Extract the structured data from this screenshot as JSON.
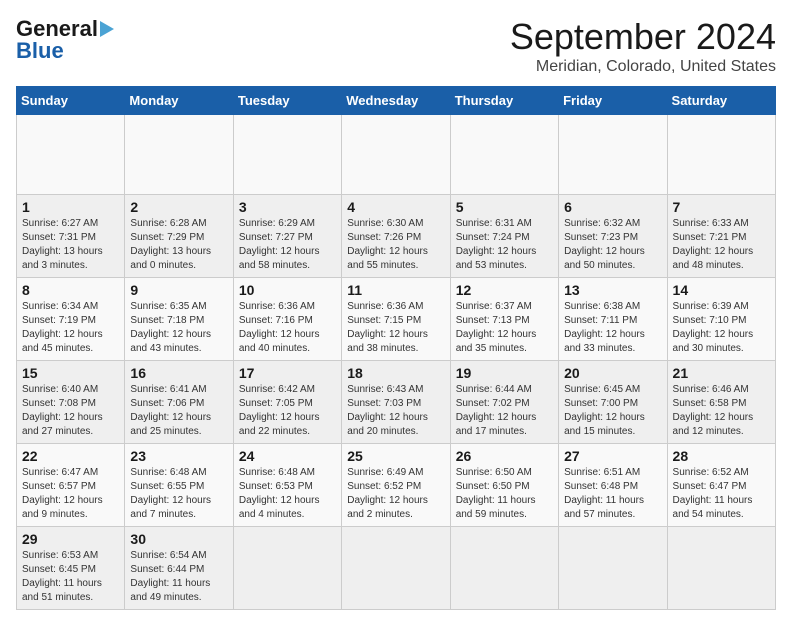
{
  "header": {
    "logo_line1": "General",
    "logo_line2": "Blue",
    "title": "September 2024",
    "subtitle": "Meridian, Colorado, United States"
  },
  "calendar": {
    "days_of_week": [
      "Sunday",
      "Monday",
      "Tuesday",
      "Wednesday",
      "Thursday",
      "Friday",
      "Saturday"
    ],
    "weeks": [
      [
        {
          "day": "",
          "info": ""
        },
        {
          "day": "",
          "info": ""
        },
        {
          "day": "",
          "info": ""
        },
        {
          "day": "",
          "info": ""
        },
        {
          "day": "",
          "info": ""
        },
        {
          "day": "",
          "info": ""
        },
        {
          "day": "",
          "info": ""
        }
      ],
      [
        {
          "day": "1",
          "info": "Sunrise: 6:27 AM\nSunset: 7:31 PM\nDaylight: 13 hours\nand 3 minutes."
        },
        {
          "day": "2",
          "info": "Sunrise: 6:28 AM\nSunset: 7:29 PM\nDaylight: 13 hours\nand 0 minutes."
        },
        {
          "day": "3",
          "info": "Sunrise: 6:29 AM\nSunset: 7:27 PM\nDaylight: 12 hours\nand 58 minutes."
        },
        {
          "day": "4",
          "info": "Sunrise: 6:30 AM\nSunset: 7:26 PM\nDaylight: 12 hours\nand 55 minutes."
        },
        {
          "day": "5",
          "info": "Sunrise: 6:31 AM\nSunset: 7:24 PM\nDaylight: 12 hours\nand 53 minutes."
        },
        {
          "day": "6",
          "info": "Sunrise: 6:32 AM\nSunset: 7:23 PM\nDaylight: 12 hours\nand 50 minutes."
        },
        {
          "day": "7",
          "info": "Sunrise: 6:33 AM\nSunset: 7:21 PM\nDaylight: 12 hours\nand 48 minutes."
        }
      ],
      [
        {
          "day": "8",
          "info": "Sunrise: 6:34 AM\nSunset: 7:19 PM\nDaylight: 12 hours\nand 45 minutes."
        },
        {
          "day": "9",
          "info": "Sunrise: 6:35 AM\nSunset: 7:18 PM\nDaylight: 12 hours\nand 43 minutes."
        },
        {
          "day": "10",
          "info": "Sunrise: 6:36 AM\nSunset: 7:16 PM\nDaylight: 12 hours\nand 40 minutes."
        },
        {
          "day": "11",
          "info": "Sunrise: 6:36 AM\nSunset: 7:15 PM\nDaylight: 12 hours\nand 38 minutes."
        },
        {
          "day": "12",
          "info": "Sunrise: 6:37 AM\nSunset: 7:13 PM\nDaylight: 12 hours\nand 35 minutes."
        },
        {
          "day": "13",
          "info": "Sunrise: 6:38 AM\nSunset: 7:11 PM\nDaylight: 12 hours\nand 33 minutes."
        },
        {
          "day": "14",
          "info": "Sunrise: 6:39 AM\nSunset: 7:10 PM\nDaylight: 12 hours\nand 30 minutes."
        }
      ],
      [
        {
          "day": "15",
          "info": "Sunrise: 6:40 AM\nSunset: 7:08 PM\nDaylight: 12 hours\nand 27 minutes."
        },
        {
          "day": "16",
          "info": "Sunrise: 6:41 AM\nSunset: 7:06 PM\nDaylight: 12 hours\nand 25 minutes."
        },
        {
          "day": "17",
          "info": "Sunrise: 6:42 AM\nSunset: 7:05 PM\nDaylight: 12 hours\nand 22 minutes."
        },
        {
          "day": "18",
          "info": "Sunrise: 6:43 AM\nSunset: 7:03 PM\nDaylight: 12 hours\nand 20 minutes."
        },
        {
          "day": "19",
          "info": "Sunrise: 6:44 AM\nSunset: 7:02 PM\nDaylight: 12 hours\nand 17 minutes."
        },
        {
          "day": "20",
          "info": "Sunrise: 6:45 AM\nSunset: 7:00 PM\nDaylight: 12 hours\nand 15 minutes."
        },
        {
          "day": "21",
          "info": "Sunrise: 6:46 AM\nSunset: 6:58 PM\nDaylight: 12 hours\nand 12 minutes."
        }
      ],
      [
        {
          "day": "22",
          "info": "Sunrise: 6:47 AM\nSunset: 6:57 PM\nDaylight: 12 hours\nand 9 minutes."
        },
        {
          "day": "23",
          "info": "Sunrise: 6:48 AM\nSunset: 6:55 PM\nDaylight: 12 hours\nand 7 minutes."
        },
        {
          "day": "24",
          "info": "Sunrise: 6:48 AM\nSunset: 6:53 PM\nDaylight: 12 hours\nand 4 minutes."
        },
        {
          "day": "25",
          "info": "Sunrise: 6:49 AM\nSunset: 6:52 PM\nDaylight: 12 hours\nand 2 minutes."
        },
        {
          "day": "26",
          "info": "Sunrise: 6:50 AM\nSunset: 6:50 PM\nDaylight: 11 hours\nand 59 minutes."
        },
        {
          "day": "27",
          "info": "Sunrise: 6:51 AM\nSunset: 6:48 PM\nDaylight: 11 hours\nand 57 minutes."
        },
        {
          "day": "28",
          "info": "Sunrise: 6:52 AM\nSunset: 6:47 PM\nDaylight: 11 hours\nand 54 minutes."
        }
      ],
      [
        {
          "day": "29",
          "info": "Sunrise: 6:53 AM\nSunset: 6:45 PM\nDaylight: 11 hours\nand 51 minutes."
        },
        {
          "day": "30",
          "info": "Sunrise: 6:54 AM\nSunset: 6:44 PM\nDaylight: 11 hours\nand 49 minutes."
        },
        {
          "day": "",
          "info": ""
        },
        {
          "day": "",
          "info": ""
        },
        {
          "day": "",
          "info": ""
        },
        {
          "day": "",
          "info": ""
        },
        {
          "day": "",
          "info": ""
        }
      ]
    ]
  }
}
